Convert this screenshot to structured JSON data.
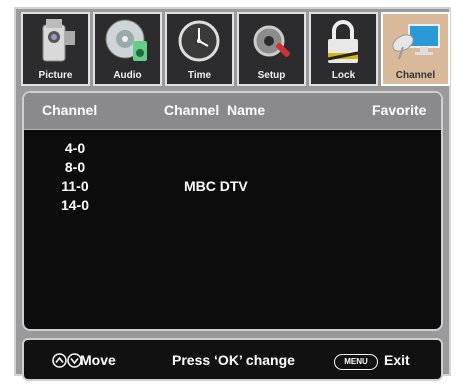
{
  "tabs": [
    {
      "label": "Picture",
      "icon": "camera-icon"
    },
    {
      "label": "Audio",
      "icon": "speaker-disc-icon"
    },
    {
      "label": "Time",
      "icon": "clock-icon"
    },
    {
      "label": "Setup",
      "icon": "gear-wrench-icon"
    },
    {
      "label": "Lock",
      "icon": "lock-icon"
    },
    {
      "label": "Channel",
      "icon": "satellite-monitor-icon"
    }
  ],
  "active_tab": "Channel",
  "table": {
    "headers": {
      "channel": "Channel",
      "name": "Channel  Name",
      "favorite": "Favorite"
    },
    "rows": [
      {
        "channel": "4-0",
        "name": ""
      },
      {
        "channel": "8-0",
        "name": ""
      },
      {
        "channel": "11-0",
        "name": "MBC DTV"
      },
      {
        "channel": "14-0",
        "name": ""
      }
    ]
  },
  "footer": {
    "move": "Move",
    "change": "Press ‘OK’ change",
    "menu_key": "MENU",
    "exit": "Exit"
  },
  "colors": {
    "frame": "#9a9a9c",
    "panel": "#0c0c0c",
    "active_tab": "#d8b99a"
  }
}
